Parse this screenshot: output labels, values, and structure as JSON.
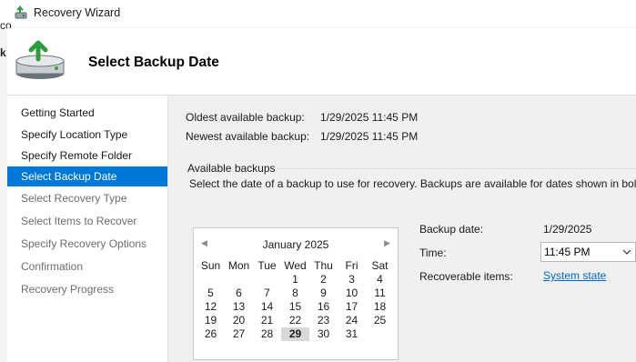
{
  "window": {
    "title": "Recovery Wizard",
    "icon": "recovery-wizard-icon"
  },
  "background_window": {
    "fragments": [
      "co",
      "k"
    ]
  },
  "header": {
    "title": "Select Backup Date",
    "icon": "backup-drive-icon"
  },
  "steps": [
    {
      "label": "Getting Started",
      "state": "done"
    },
    {
      "label": "Specify Location Type",
      "state": "done"
    },
    {
      "label": "Specify Remote Folder",
      "state": "done"
    },
    {
      "label": "Select Backup Date",
      "state": "active"
    },
    {
      "label": "Select Recovery Type",
      "state": "pending"
    },
    {
      "label": "Select Items to Recover",
      "state": "pending"
    },
    {
      "label": "Specify Recovery Options",
      "state": "pending"
    },
    {
      "label": "Confirmation",
      "state": "pending"
    },
    {
      "label": "Recovery Progress",
      "state": "pending"
    }
  ],
  "info": {
    "oldest_label": "Oldest available backup:",
    "oldest_value": "1/29/2025 11:45 PM",
    "newest_label": "Newest available backup:",
    "newest_value": "1/29/2025 11:45 PM"
  },
  "available": {
    "group_label": "Available backups",
    "instructions": "Select the date of a backup to use for recovery. Backups are available for dates shown in bold."
  },
  "calendar": {
    "month": "January 2025",
    "prev_icon": "chevron-left-icon",
    "next_icon": "chevron-right-icon",
    "weekdays": [
      "Sun",
      "Mon",
      "Tue",
      "Wed",
      "Thu",
      "Fri",
      "Sat"
    ],
    "weeks": [
      [
        "",
        "",
        "",
        "1",
        "2",
        "3",
        "4"
      ],
      [
        "5",
        "6",
        "7",
        "8",
        "9",
        "10",
        "11"
      ],
      [
        "12",
        "13",
        "14",
        "15",
        "16",
        "17",
        "18"
      ],
      [
        "19",
        "20",
        "21",
        "22",
        "23",
        "24",
        "25"
      ],
      [
        "26",
        "27",
        "28",
        "29",
        "30",
        "31",
        ""
      ]
    ],
    "selected_day": "29"
  },
  "details": {
    "backup_date_label": "Backup date:",
    "backup_date_value": "1/29/2025",
    "time_label": "Time:",
    "time_value": "11:45 PM",
    "recoverable_label": "Recoverable items:",
    "recoverable_link": "System state"
  },
  "colors": {
    "accent": "#0078d7",
    "link": "#0066cc",
    "panel_bg": "#f0f0f0"
  }
}
